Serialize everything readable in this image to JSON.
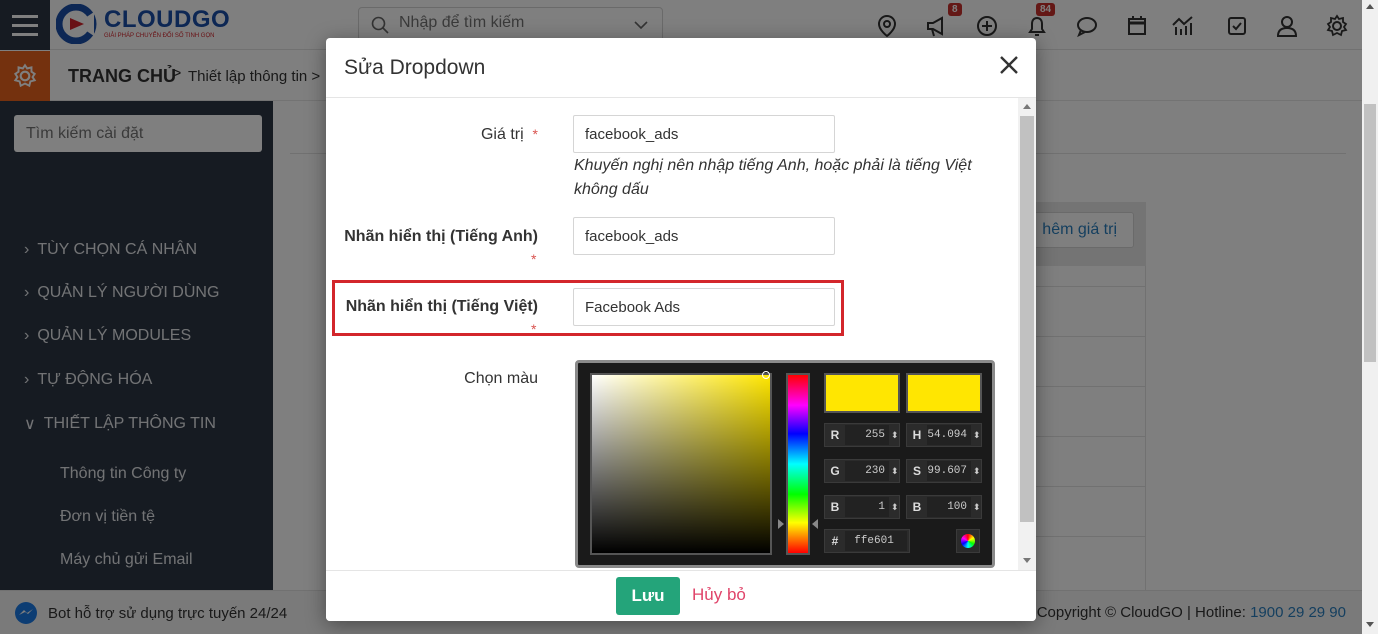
{
  "header": {
    "logo_text": "CLOUDGO",
    "logo_tagline": "GIẢI PHÁP CHUYỂN ĐỔI SỐ TINH GỌN",
    "search_placeholder": "Nhập để tìm kiếm",
    "icons": [
      {
        "name": "location-pin-icon"
      },
      {
        "name": "megaphone-icon",
        "badge": "8"
      },
      {
        "name": "plus-circle-icon"
      },
      {
        "name": "bell-icon",
        "badge": "84"
      },
      {
        "name": "chat-bubble-icon"
      },
      {
        "name": "calendar-icon"
      },
      {
        "name": "chart-icon"
      },
      {
        "name": "checkbox-icon"
      },
      {
        "name": "user-icon"
      },
      {
        "name": "settings-icon"
      }
    ]
  },
  "breadcrumb": {
    "home": "TRANG CHỦ",
    "separator": ">",
    "current": "Thiết lập thông tin >"
  },
  "sidebar": {
    "search_placeholder": "Tìm kiếm cài đặt",
    "items": [
      {
        "label": "TÙY CHỌN CÁ NHÂN",
        "expanded": false
      },
      {
        "label": "QUẢN LÝ NGƯỜI DÙNG",
        "expanded": false
      },
      {
        "label": "QUẢN LÝ MODULES",
        "expanded": false
      },
      {
        "label": "TỰ ĐỘNG HÓA",
        "expanded": false
      },
      {
        "label": "THIẾT LẬP THÔNG TIN",
        "expanded": true
      }
    ],
    "sub_items": [
      {
        "label": "Thông tin Công ty"
      },
      {
        "label": "Đơn vị tiền tệ"
      },
      {
        "label": "Máy chủ gửi Email"
      }
    ]
  },
  "background": {
    "add_value_button": "hêm giá trị"
  },
  "footer": {
    "bot_text": "Bot hỗ trợ sử dụng trực tuyến 24/24",
    "copyright": "Copyright © CloudGO | Hotline: ",
    "hotline": "1900 29 29 90"
  },
  "modal": {
    "title": "Sửa Dropdown",
    "fields": {
      "value": {
        "label": "Giá trị",
        "required_mark": "*",
        "value": "facebook_ads",
        "hint": "Khuyến nghị nên nhập tiếng Anh, hoặc phải là tiếng Việt không dấu"
      },
      "label_en": {
        "label": "Nhãn hiển thị (Tiếng Anh)",
        "required_mark": "*",
        "value": "facebook_ads"
      },
      "label_vi": {
        "label": "Nhãn hiển thị (Tiếng Việt)",
        "required_mark": "*",
        "value": "Facebook Ads"
      },
      "color": {
        "label": "Chọn màu"
      }
    },
    "color_picker": {
      "current_color": "#ffe601",
      "previous_color": "#ffe601",
      "r_label": "R",
      "r": "255",
      "g_label": "G",
      "g": "230",
      "b_label": "B",
      "b": "1",
      "h_label": "H",
      "h": "54.094",
      "s_label": "S",
      "s": "99.607",
      "v_label": "B",
      "v": "100",
      "hex_label": "#",
      "hex": "ffe601"
    },
    "save_button": "Lưu",
    "cancel_button": "Hủy bỏ"
  },
  "colors": {
    "sidebar_bg": "#2d3745",
    "accent_orange": "#e8631d",
    "save_green": "#24a47a",
    "cancel_pink": "#e0446a",
    "highlight_red": "#d3262b",
    "picked_yellow": "#ffe601"
  }
}
